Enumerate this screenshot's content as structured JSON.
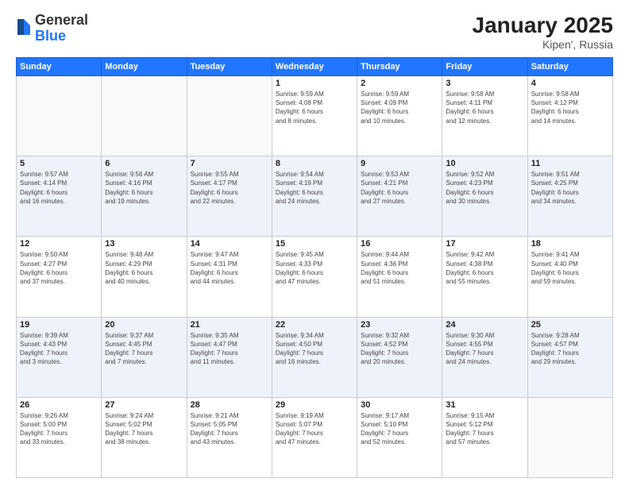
{
  "logo": {
    "general": "General",
    "blue": "Blue"
  },
  "header": {
    "month": "January 2025",
    "location": "Kipen', Russia"
  },
  "weekdays": [
    "Sunday",
    "Monday",
    "Tuesday",
    "Wednesday",
    "Thursday",
    "Friday",
    "Saturday"
  ],
  "weeks": [
    [
      {
        "day": "",
        "info": ""
      },
      {
        "day": "",
        "info": ""
      },
      {
        "day": "",
        "info": ""
      },
      {
        "day": "1",
        "info": "Sunrise: 9:59 AM\nSunset: 4:08 PM\nDaylight: 6 hours\nand 8 minutes."
      },
      {
        "day": "2",
        "info": "Sunrise: 9:59 AM\nSunset: 4:09 PM\nDaylight: 6 hours\nand 10 minutes."
      },
      {
        "day": "3",
        "info": "Sunrise: 9:58 AM\nSunset: 4:11 PM\nDaylight: 6 hours\nand 12 minutes."
      },
      {
        "day": "4",
        "info": "Sunrise: 9:58 AM\nSunset: 4:12 PM\nDaylight: 6 hours\nand 14 minutes."
      }
    ],
    [
      {
        "day": "5",
        "info": "Sunrise: 9:57 AM\nSunset: 4:14 PM\nDaylight: 6 hours\nand 16 minutes."
      },
      {
        "day": "6",
        "info": "Sunrise: 9:56 AM\nSunset: 4:16 PM\nDaylight: 6 hours\nand 19 minutes."
      },
      {
        "day": "7",
        "info": "Sunrise: 9:55 AM\nSunset: 4:17 PM\nDaylight: 6 hours\nand 22 minutes."
      },
      {
        "day": "8",
        "info": "Sunrise: 9:54 AM\nSunset: 4:19 PM\nDaylight: 6 hours\nand 24 minutes."
      },
      {
        "day": "9",
        "info": "Sunrise: 9:53 AM\nSunset: 4:21 PM\nDaylight: 6 hours\nand 27 minutes."
      },
      {
        "day": "10",
        "info": "Sunrise: 9:52 AM\nSunset: 4:23 PM\nDaylight: 6 hours\nand 30 minutes."
      },
      {
        "day": "11",
        "info": "Sunrise: 9:51 AM\nSunset: 4:25 PM\nDaylight: 6 hours\nand 34 minutes."
      }
    ],
    [
      {
        "day": "12",
        "info": "Sunrise: 9:50 AM\nSunset: 4:27 PM\nDaylight: 6 hours\nand 37 minutes."
      },
      {
        "day": "13",
        "info": "Sunrise: 9:48 AM\nSunset: 4:29 PM\nDaylight: 6 hours\nand 40 minutes."
      },
      {
        "day": "14",
        "info": "Sunrise: 9:47 AM\nSunset: 4:31 PM\nDaylight: 6 hours\nand 44 minutes."
      },
      {
        "day": "15",
        "info": "Sunrise: 9:45 AM\nSunset: 4:33 PM\nDaylight: 6 hours\nand 47 minutes."
      },
      {
        "day": "16",
        "info": "Sunrise: 9:44 AM\nSunset: 4:36 PM\nDaylight: 6 hours\nand 51 minutes."
      },
      {
        "day": "17",
        "info": "Sunrise: 9:42 AM\nSunset: 4:38 PM\nDaylight: 6 hours\nand 55 minutes."
      },
      {
        "day": "18",
        "info": "Sunrise: 9:41 AM\nSunset: 4:40 PM\nDaylight: 6 hours\nand 59 minutes."
      }
    ],
    [
      {
        "day": "19",
        "info": "Sunrise: 9:39 AM\nSunset: 4:43 PM\nDaylight: 7 hours\nand 3 minutes."
      },
      {
        "day": "20",
        "info": "Sunrise: 9:37 AM\nSunset: 4:45 PM\nDaylight: 7 hours\nand 7 minutes."
      },
      {
        "day": "21",
        "info": "Sunrise: 9:35 AM\nSunset: 4:47 PM\nDaylight: 7 hours\nand 11 minutes."
      },
      {
        "day": "22",
        "info": "Sunrise: 9:34 AM\nSunset: 4:50 PM\nDaylight: 7 hours\nand 16 minutes."
      },
      {
        "day": "23",
        "info": "Sunrise: 9:32 AM\nSunset: 4:52 PM\nDaylight: 7 hours\nand 20 minutes."
      },
      {
        "day": "24",
        "info": "Sunrise: 9:30 AM\nSunset: 4:55 PM\nDaylight: 7 hours\nand 24 minutes."
      },
      {
        "day": "25",
        "info": "Sunrise: 9:28 AM\nSunset: 4:57 PM\nDaylight: 7 hours\nand 29 minutes."
      }
    ],
    [
      {
        "day": "26",
        "info": "Sunrise: 9:26 AM\nSunset: 5:00 PM\nDaylight: 7 hours\nand 33 minutes."
      },
      {
        "day": "27",
        "info": "Sunrise: 9:24 AM\nSunset: 5:02 PM\nDaylight: 7 hours\nand 38 minutes."
      },
      {
        "day": "28",
        "info": "Sunrise: 9:21 AM\nSunset: 5:05 PM\nDaylight: 7 hours\nand 43 minutes."
      },
      {
        "day": "29",
        "info": "Sunrise: 9:19 AM\nSunset: 5:07 PM\nDaylight: 7 hours\nand 47 minutes."
      },
      {
        "day": "30",
        "info": "Sunrise: 9:17 AM\nSunset: 5:10 PM\nDaylight: 7 hours\nand 52 minutes."
      },
      {
        "day": "31",
        "info": "Sunrise: 9:15 AM\nSunset: 5:12 PM\nDaylight: 7 hours\nand 57 minutes."
      },
      {
        "day": "",
        "info": ""
      }
    ]
  ]
}
